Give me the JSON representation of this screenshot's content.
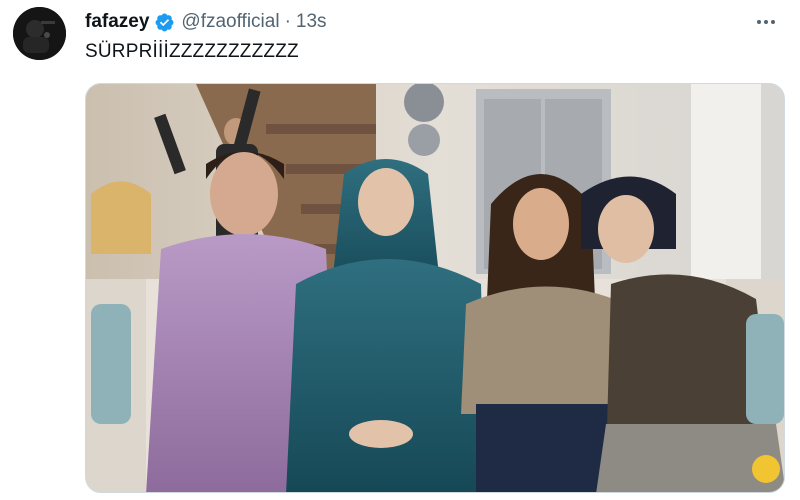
{
  "tweet": {
    "author": {
      "display_name": "fafazey",
      "handle": "@fzaofficial",
      "verified": true,
      "avatar_icon": "profile-photo-dark"
    },
    "separator": "·",
    "timestamp": "13s",
    "text": "SÜRPRİİİZZZZZZZZZZZ",
    "more_icon": "ellipsis-icon",
    "media": {
      "type": "photo",
      "subject": "four women sitting on a sofa in a living room set"
    }
  },
  "colors": {
    "verified_badge": "#1d9bf0",
    "text_primary": "#0f1419",
    "text_secondary": "#536471",
    "border": "#cfd9de"
  }
}
